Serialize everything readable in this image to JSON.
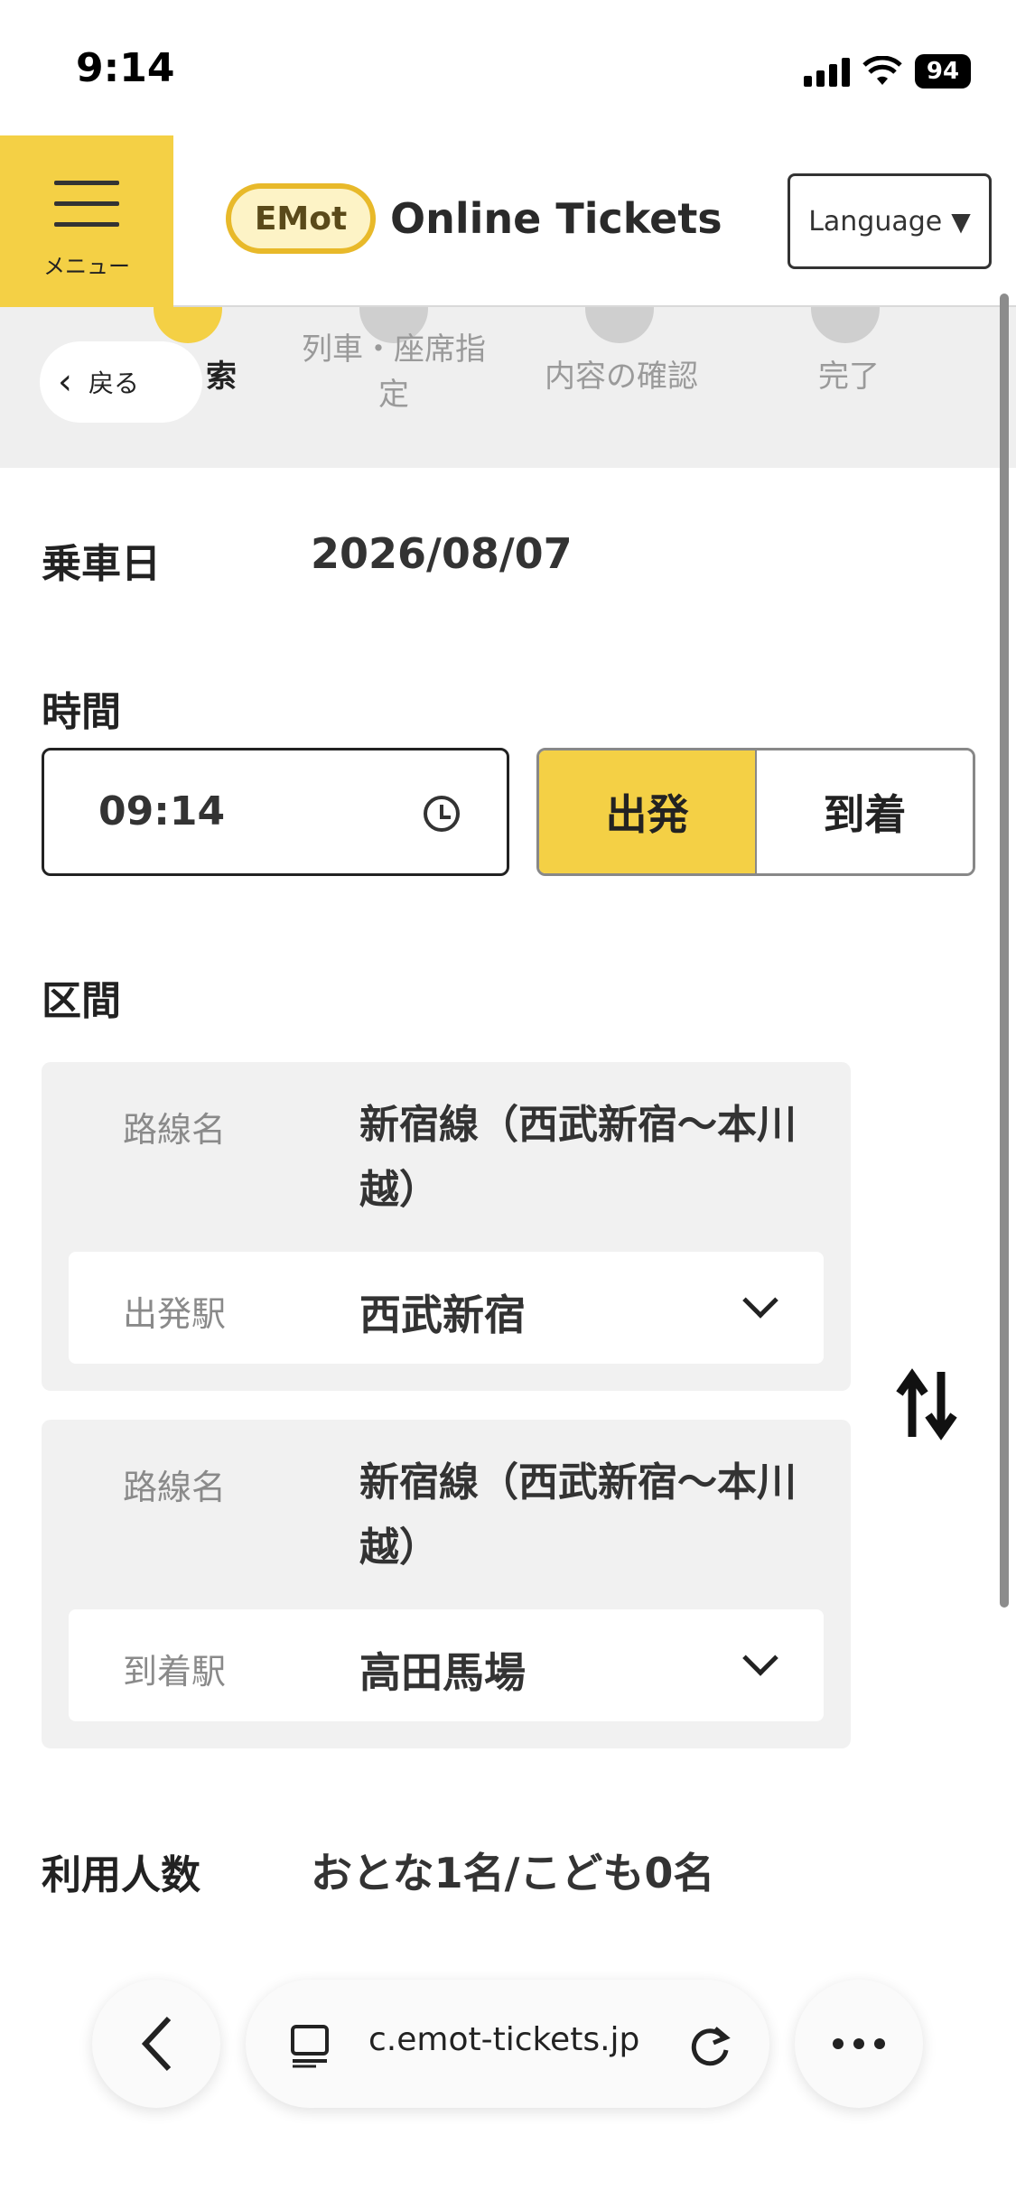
{
  "status_bar": {
    "time": "9:14",
    "battery": "94"
  },
  "header": {
    "menu_label": "メニュー",
    "logo_badge": "EMot",
    "logo_text": "Online Tickets",
    "language_label": "Language",
    "language_arrow": "▼"
  },
  "steps": {
    "back_label": "戻る",
    "items": [
      {
        "label": "索"
      },
      {
        "label": "列車・座席指定"
      },
      {
        "label": "内容の確認"
      },
      {
        "label": "完了"
      }
    ]
  },
  "form": {
    "date_label": "乗車日",
    "date_value": "2026/08/07",
    "time_label": "時間",
    "time_value": "09:14",
    "departure_label": "出発",
    "arrival_label": "到着",
    "section_label": "区間",
    "departure_block": {
      "line_label": "路線名",
      "line_value": "新宿線（西武新宿～本川越）",
      "station_label": "出発駅",
      "station_value": "西武新宿"
    },
    "arrival_block": {
      "line_label": "路線名",
      "line_value": "新宿線（西武新宿～本川越）",
      "station_label": "到着駅",
      "station_value": "高田馬場"
    },
    "passengers_label": "利用人数",
    "passengers_value": "おとな1名/こども0名"
  },
  "browser": {
    "url": "c.emot-tickets.jp",
    "back_icon": "chevron-left-icon",
    "more_icon": "more-icon"
  },
  "colors": {
    "accent": "#f4d045",
    "panel": "#f1f1f1",
    "muted_text": "#8a8a8a"
  }
}
